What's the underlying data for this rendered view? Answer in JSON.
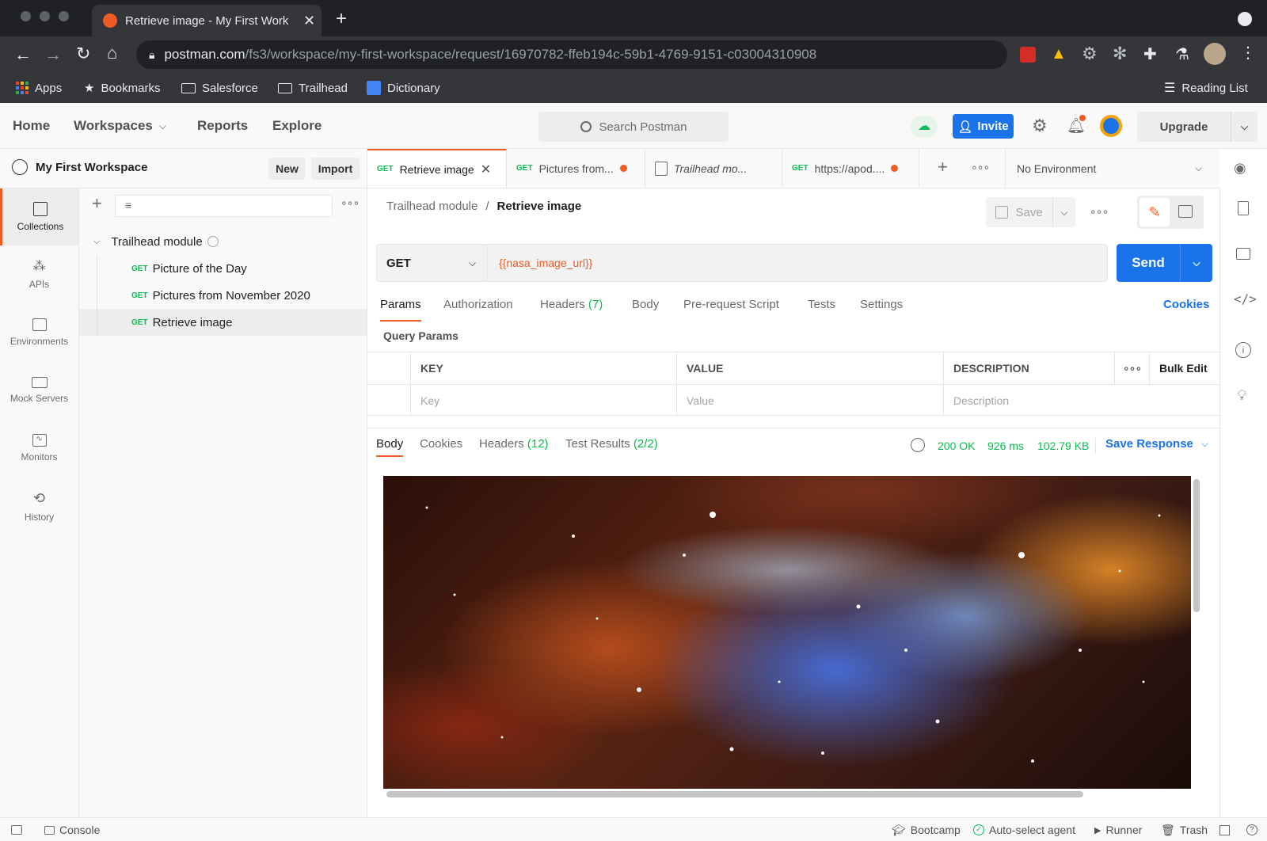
{
  "browser": {
    "tab_title": "Retrieve image - My First Work",
    "url_host": "postman.com",
    "url_path": "/fs3/workspace/my-first-workspace/request/16970782-ffeb194c-59b1-4769-9151-c03004310908",
    "bookmarks": [
      "Apps",
      "Bookmarks",
      "Salesforce",
      "Trailhead",
      "Dictionary"
    ],
    "reading_list": "Reading List"
  },
  "topnav": {
    "home": "Home",
    "workspaces": "Workspaces",
    "reports": "Reports",
    "explore": "Explore",
    "search_placeholder": "Search Postman",
    "invite": "Invite",
    "upgrade": "Upgrade"
  },
  "workspace": {
    "name": "My First Workspace",
    "new": "New",
    "import": "Import"
  },
  "rail": [
    "Collections",
    "APIs",
    "Environments",
    "Mock Servers",
    "Monitors",
    "History"
  ],
  "collection": {
    "name": "Trailhead module",
    "requests": [
      {
        "method": "GET",
        "name": "Picture of the Day"
      },
      {
        "method": "GET",
        "name": "Pictures from November 2020"
      },
      {
        "method": "GET",
        "name": "Retrieve image"
      }
    ]
  },
  "request_tabs": [
    {
      "method": "GET",
      "label": "Retrieve image"
    },
    {
      "method": "GET",
      "label": "Pictures from..."
    },
    {
      "method": "",
      "label": "Trailhead mo..."
    },
    {
      "method": "GET",
      "label": "https://apod...."
    }
  ],
  "environment": "No Environment",
  "breadcrumb": {
    "parent": "Trailhead module",
    "sep": "/",
    "current": "Retrieve image"
  },
  "save": "Save",
  "request": {
    "method": "GET",
    "url": "{{nasa_image_url}}",
    "send": "Send"
  },
  "param_tabs": {
    "params": "Params",
    "authorization": "Authorization",
    "headers": "Headers",
    "headers_count": "(7)",
    "body": "Body",
    "prerequest": "Pre-request Script",
    "tests": "Tests",
    "settings": "Settings",
    "cookies": "Cookies"
  },
  "query_params": {
    "title": "Query Params",
    "headers": [
      "KEY",
      "VALUE",
      "DESCRIPTION"
    ],
    "placeholders": [
      "Key",
      "Value",
      "Description"
    ],
    "bulk_edit": "Bulk Edit"
  },
  "response": {
    "tabs": {
      "body": "Body",
      "cookies": "Cookies",
      "headers": "Headers",
      "headers_count": "(12)",
      "tests": "Test Results",
      "tests_count": "(2/2)"
    },
    "status": "200 OK",
    "time": "926 ms",
    "size": "102.79 KB",
    "save_response": "Save Response"
  },
  "statusbar": {
    "console": "Console",
    "bootcamp": "Bootcamp",
    "agent": "Auto-select agent",
    "runner": "Runner",
    "trash": "Trash"
  },
  "colors": {
    "accent": "#ef5b25",
    "primary": "#1a73e8",
    "success": "#0cbb52",
    "url_var": "#ef5b25"
  }
}
